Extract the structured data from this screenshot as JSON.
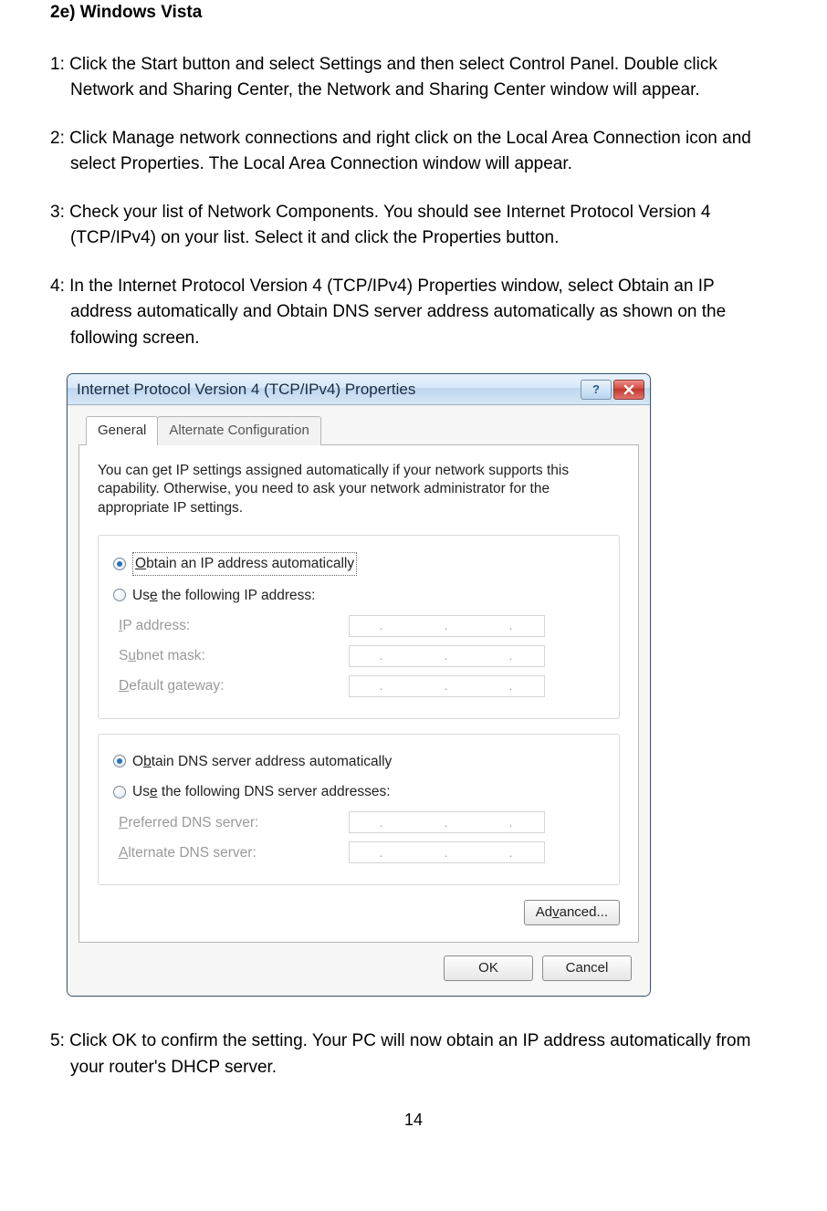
{
  "doc": {
    "section_title": "2e) Windows Vista",
    "steps": {
      "s1": "1: Click the Start button and select Settings and then select Control Panel.  Double click Network   and Sharing Center, the Network and Sharing Center window will appear.",
      "s2": "2: Click Manage network connections and right click on the Local Area Connection icon and select Properties. The Local Area Connection window will appear.",
      "s3": "3: Check your list of Network Components. You should see Internet Protocol Version 4 (TCP/IPv4) on your list. Select it and click the Properties button.",
      "s4": "4: In the Internet Protocol Version 4 (TCP/IPv4) Properties window, select Obtain an IP address automatically and Obtain DNS server address automatically as shown on the following screen.",
      "s5": "5: Click OK to confirm the setting. Your PC will now obtain an IP address automatically from your router's DHCP server."
    },
    "page_number": "14"
  },
  "dialog": {
    "title": "Internet Protocol Version 4 (TCP/IPv4) Properties",
    "help_symbol": "?",
    "tabs": {
      "general": "General",
      "alternate": "Alternate Configuration"
    },
    "description": "You can get IP settings assigned automatically if your network supports this capability. Otherwise, you need to ask your network administrator for the appropriate IP settings.",
    "ip_group": {
      "auto_prefix": "O",
      "auto_rest": "btain an IP address automatically",
      "manual_prefix": "Us",
      "manual_u": "e",
      "manual_rest": " the following IP address:",
      "ip_label_prefix": "I",
      "ip_label_rest": "P address:",
      "subnet_prefix": "S",
      "subnet_u": "u",
      "subnet_rest": "bnet mask:",
      "gateway_prefix": "D",
      "gateway_rest": "efault gateway:"
    },
    "dns_group": {
      "auto_prefix": "O",
      "auto_u": "b",
      "auto_rest": "tain DNS server address automatically",
      "manual_prefix": "Us",
      "manual_u": "e",
      "manual_rest": " the following DNS server addresses:",
      "pref_prefix": "P",
      "pref_rest": "referred DNS server:",
      "alt_prefix": "A",
      "alt_rest": "lternate DNS server:"
    },
    "buttons": {
      "advanced_prefix": "Ad",
      "advanced_u": "v",
      "advanced_rest": "anced...",
      "ok": "OK",
      "cancel": "Cancel"
    }
  }
}
